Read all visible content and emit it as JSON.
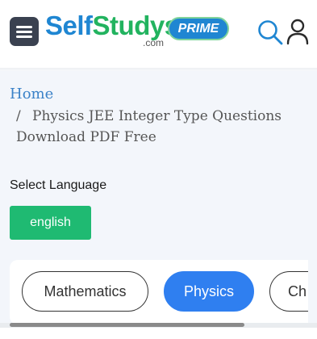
{
  "header": {
    "menu_icon": "hamburger-menu-icon",
    "logo": {
      "self": "Self",
      "studys": "Studys",
      "domain": ".com",
      "badge": "PRIME"
    },
    "search_icon": "search-icon",
    "user_icon": "user-icon"
  },
  "breadcrumb": {
    "home": "Home",
    "separator": "/",
    "current": "Physics JEE Integer Type Questions Download PDF Free"
  },
  "language": {
    "label": "Select Language",
    "selected": "english"
  },
  "subject_tabs": [
    {
      "label": "Mathematics",
      "active": false
    },
    {
      "label": "Physics",
      "active": true
    },
    {
      "label": "Ch",
      "active": false
    }
  ],
  "colors": {
    "brand_blue": "#1f86d2",
    "brand_green": "#22b35f",
    "language_button": "#1fba72",
    "active_tab": "#2f7ff0",
    "link": "#3b82c8"
  }
}
